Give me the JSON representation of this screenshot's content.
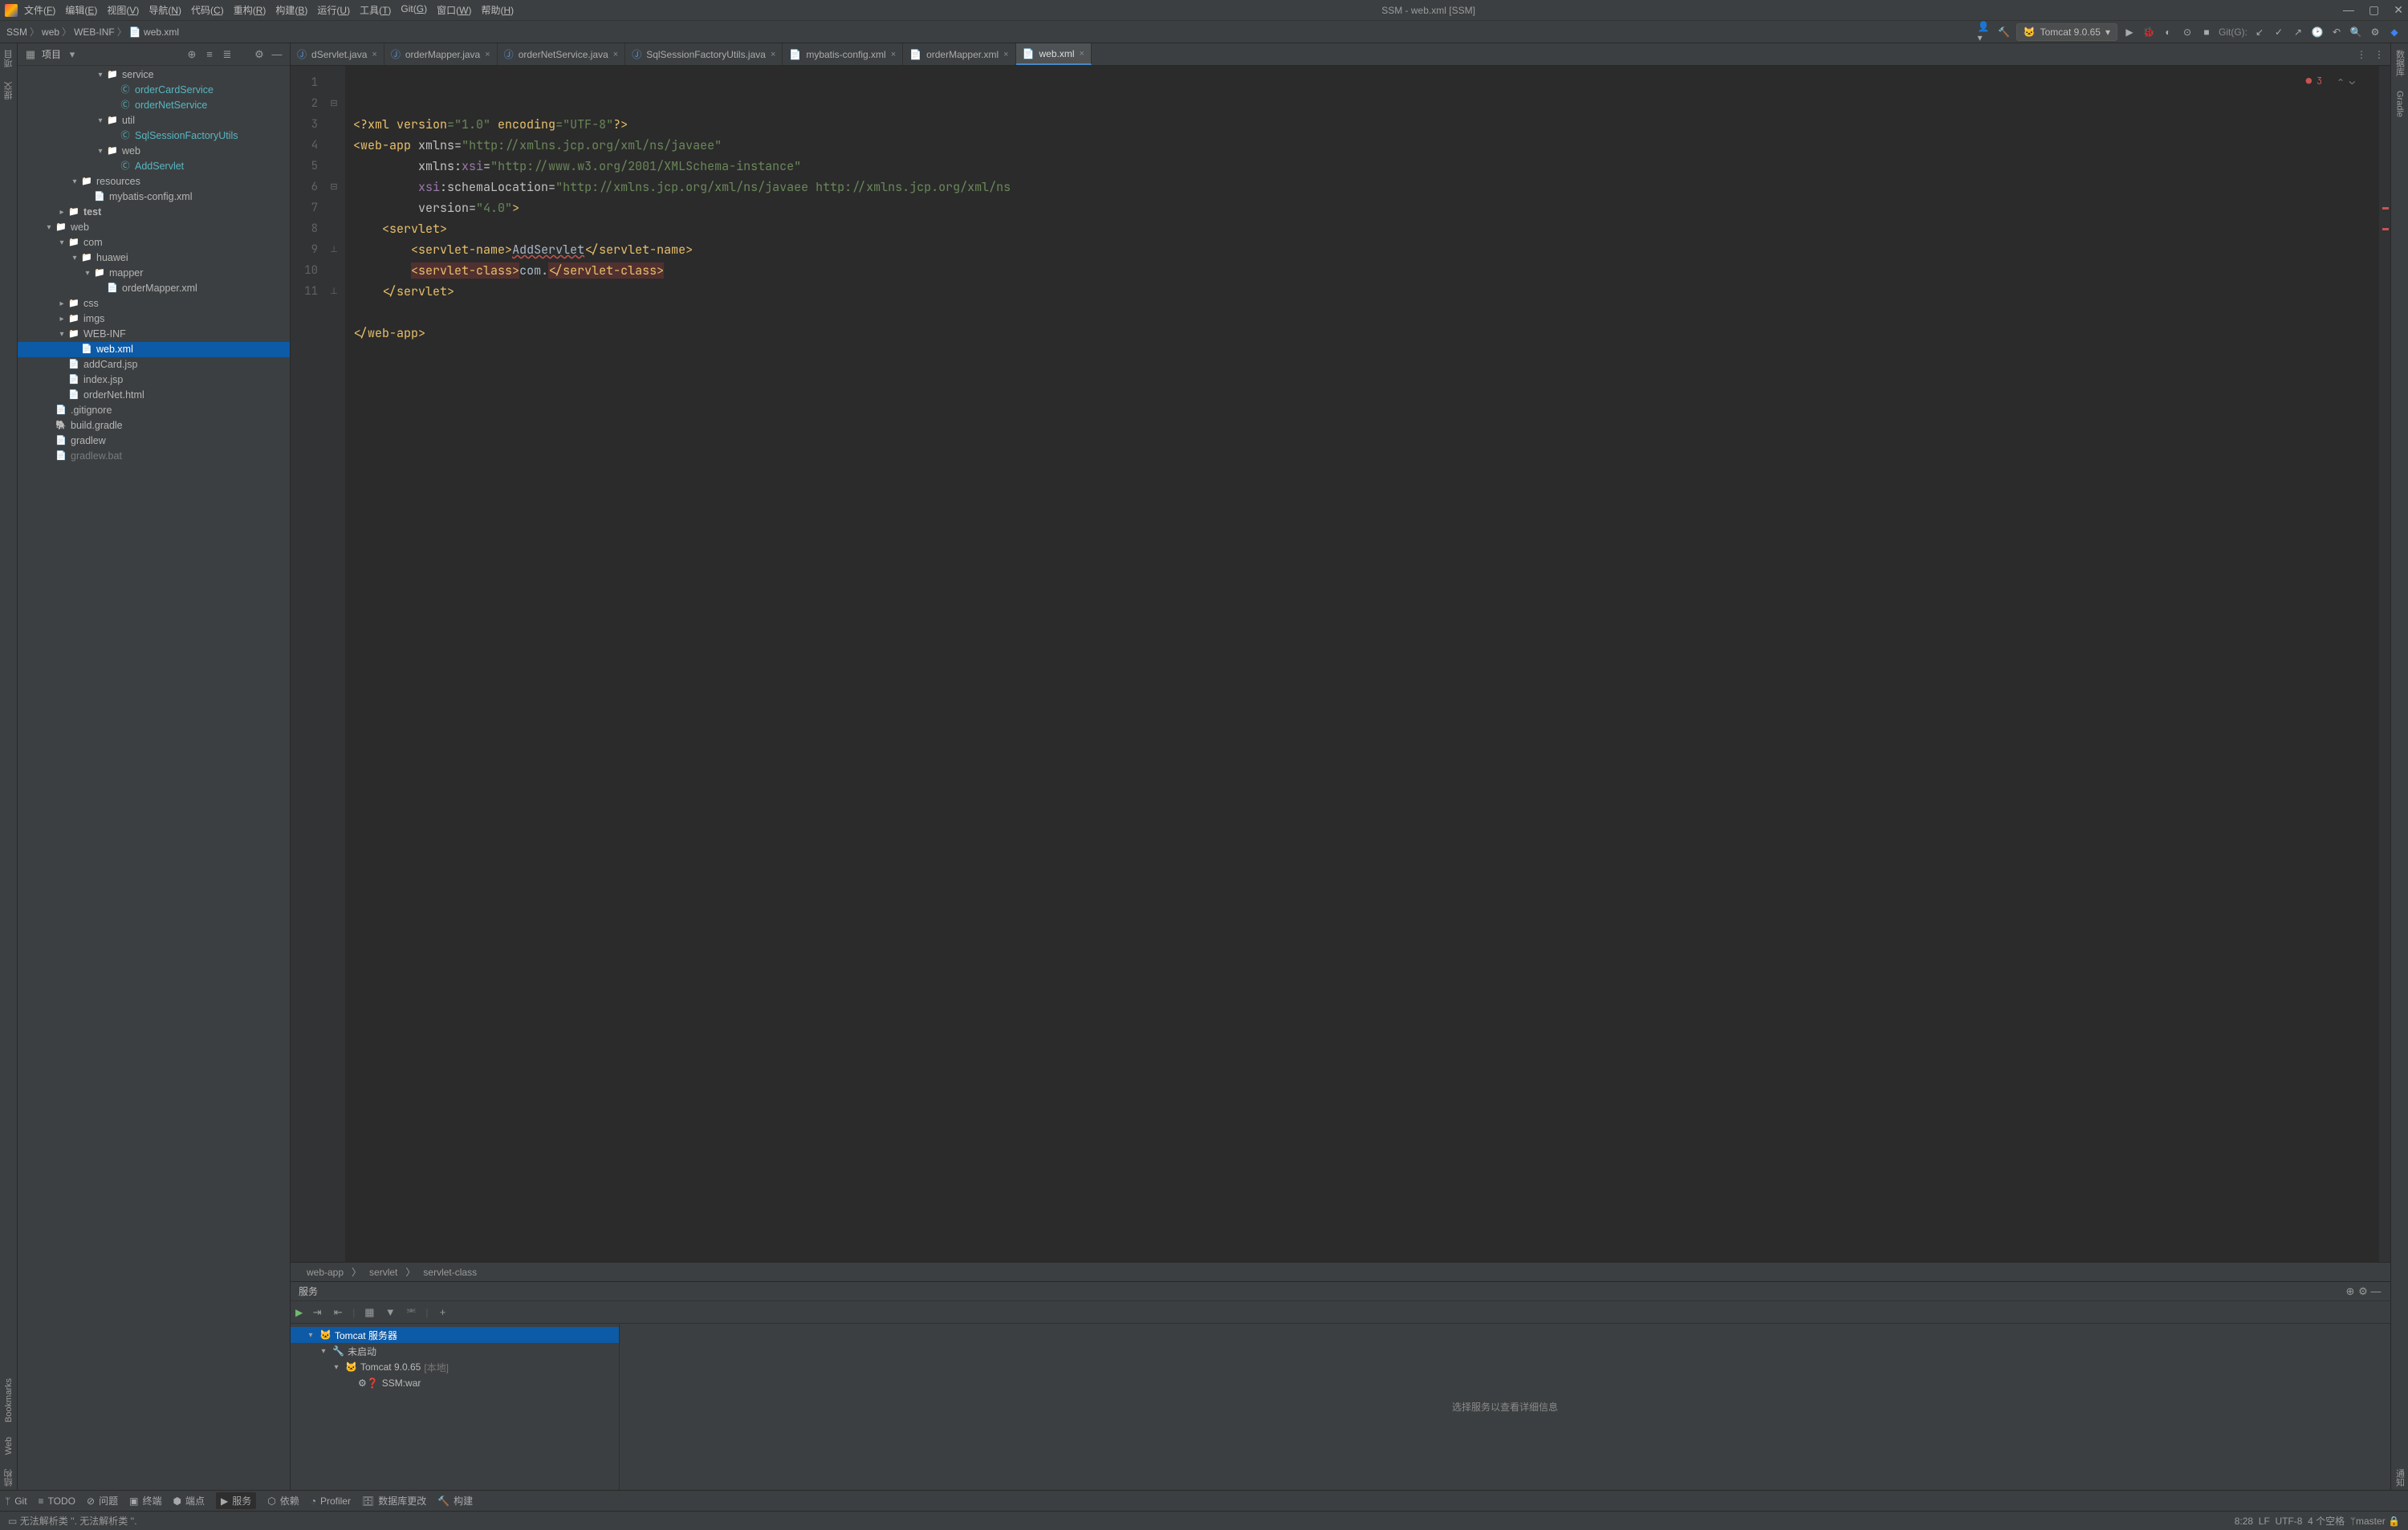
{
  "titlebar": {
    "menus": [
      "文件(F)",
      "编辑(E)",
      "视图(V)",
      "导航(N)",
      "代码(C)",
      "重构(R)",
      "构建(B)",
      "运行(U)",
      "工具(T)",
      "Git(G)",
      "窗口(W)",
      "帮助(H)"
    ],
    "title": "SSM - web.xml [SSM]"
  },
  "breadcrumb": {
    "parts": [
      "SSM",
      "web",
      "WEB-INF",
      "web.xml"
    ]
  },
  "run_config": "Tomcat 9.0.65",
  "git_label": "Git(G):",
  "left_tabs": {
    "project": "项目",
    "commit": "提交"
  },
  "left_bottom_tabs": [
    "Bookmarks",
    "Web",
    "结构"
  ],
  "right_tabs": [
    "数据库",
    "Gradle",
    "通知"
  ],
  "project_panel": {
    "title": "项目"
  },
  "tree": [
    {
      "d": 6,
      "c": "▾",
      "i": "folder",
      "t": "service"
    },
    {
      "d": 7,
      "c": "",
      "i": "class",
      "t": "orderCardService",
      "cy": true
    },
    {
      "d": 7,
      "c": "",
      "i": "class",
      "t": "orderNetService",
      "cy": true
    },
    {
      "d": 6,
      "c": "▾",
      "i": "folder",
      "t": "util"
    },
    {
      "d": 7,
      "c": "",
      "i": "class",
      "t": "SqlSessionFactoryUtils",
      "cy": true
    },
    {
      "d": 6,
      "c": "▾",
      "i": "folder",
      "t": "web"
    },
    {
      "d": 7,
      "c": "",
      "i": "class",
      "t": "AddServlet",
      "cy": true
    },
    {
      "d": 4,
      "c": "▾",
      "i": "folder",
      "t": "resources"
    },
    {
      "d": 5,
      "c": "",
      "i": "xml",
      "t": "mybatis-config.xml"
    },
    {
      "d": 3,
      "c": "▸",
      "i": "folder",
      "t": "test",
      "bold": true
    },
    {
      "d": 2,
      "c": "▾",
      "i": "folder",
      "t": "web"
    },
    {
      "d": 3,
      "c": "▾",
      "i": "folder",
      "t": "com"
    },
    {
      "d": 4,
      "c": "▾",
      "i": "folder",
      "t": "huawei"
    },
    {
      "d": 5,
      "c": "▾",
      "i": "folder",
      "t": "mapper"
    },
    {
      "d": 6,
      "c": "",
      "i": "xml",
      "t": "orderMapper.xml"
    },
    {
      "d": 3,
      "c": "▸",
      "i": "folder",
      "t": "css"
    },
    {
      "d": 3,
      "c": "▸",
      "i": "folder",
      "t": "imgs"
    },
    {
      "d": 3,
      "c": "▾",
      "i": "folder",
      "t": "WEB-INF"
    },
    {
      "d": 4,
      "c": "",
      "i": "xml",
      "t": "web.xml",
      "sel": true
    },
    {
      "d": 3,
      "c": "",
      "i": "jsp",
      "t": "addCard.jsp"
    },
    {
      "d": 3,
      "c": "",
      "i": "jsp",
      "t": "index.jsp"
    },
    {
      "d": 3,
      "c": "",
      "i": "html",
      "t": "orderNet.html"
    },
    {
      "d": 2,
      "c": "",
      "i": "txt",
      "t": ".gitignore"
    },
    {
      "d": 2,
      "c": "",
      "i": "gradle",
      "t": "build.gradle"
    },
    {
      "d": 2,
      "c": "",
      "i": "txt",
      "t": "gradlew"
    },
    {
      "d": 2,
      "c": "",
      "i": "txt",
      "t": "gradlew.bat",
      "dim": true
    }
  ],
  "editor_tabs": [
    {
      "label": "dServlet.java",
      "icon": "java"
    },
    {
      "label": "orderMapper.java",
      "icon": "java"
    },
    {
      "label": "orderNetService.java",
      "icon": "java"
    },
    {
      "label": "SqlSessionFactoryUtils.java",
      "icon": "java"
    },
    {
      "label": "mybatis-config.xml",
      "icon": "xml"
    },
    {
      "label": "orderMapper.xml",
      "icon": "xml"
    },
    {
      "label": "web.xml",
      "icon": "xml",
      "active": true
    }
  ],
  "error_count": "3",
  "code": {
    "lines": [
      1,
      2,
      3,
      4,
      5,
      6,
      7,
      8,
      9,
      10,
      11
    ],
    "l1_a": "<?",
    "l1_b": "xml version",
    "l1_c": "=\"1.0\"",
    "l1_d": " encoding",
    "l1_e": "=\"UTF-8\"",
    "l1_f": "?>",
    "l2_a": "<",
    "l2_b": "web-app ",
    "l2_c": "xmlns",
    "l2_d": "=",
    "l2_e": "\"http://xmlns.jcp.org/xml/ns/javaee\"",
    "l3_a": "xmlns:",
    "l3_b": "xsi",
    "l3_c": "=",
    "l3_d": "\"http://www.w3.org/2001/XMLSchema-instance\"",
    "l4_a": "xsi",
    "l4_b": ":schemaLocation",
    "l4_c": "=",
    "l4_d": "\"http://xmlns.jcp.org/xml/ns/javaee http://xmlns.jcp.org/xml/ns",
    "l5_a": "version",
    "l5_b": "=",
    "l5_c": "\"4.0\"",
    "l5_d": ">",
    "l6_a": "<",
    "l6_b": "servlet",
    "l6_c": ">",
    "l7_a": "<",
    "l7_b": "servlet-name",
    "l7_c": ">",
    "l7_d": "AddServlet",
    "l7_e": "</",
    "l7_f": "servlet-name",
    "l7_g": ">",
    "l8_a": "<",
    "l8_b": "servlet-class",
    "l8_c": ">",
    "l8_d": "com.",
    "l8_e": "</",
    "l8_f": "servlet-class",
    "l8_g": ">",
    "l9_a": "</",
    "l9_b": "servlet",
    "l9_c": ">",
    "l11_a": "</",
    "l11_b": "web-app",
    "l11_c": ">"
  },
  "crumb2": [
    "web-app",
    "servlet",
    "servlet-class"
  ],
  "services": {
    "panel_title": "服务",
    "root": "Tomcat 服务器",
    "state": "未启动",
    "node": "Tomcat 9.0.65",
    "node_scope": "[本地]",
    "artifact": "SSM:war",
    "placeholder": "选择服务以查看详细信息"
  },
  "bottom_tabs": [
    {
      "l": "Git",
      "i": "git"
    },
    {
      "l": "TODO",
      "i": "todo"
    },
    {
      "l": "问题",
      "i": "problems"
    },
    {
      "l": "终端",
      "i": "terminal"
    },
    {
      "l": "端点",
      "i": "endpoints"
    },
    {
      "l": "服务",
      "i": "services",
      "active": true
    },
    {
      "l": "依赖",
      "i": "deps"
    },
    {
      "l": "Profiler",
      "i": "profiler"
    },
    {
      "l": "数据库更改",
      "i": "dbchanges"
    },
    {
      "l": "构建",
      "i": "build"
    }
  ],
  "status": {
    "msg": "无法解析类 ''. 无法解析类 ''.",
    "pos": "8:28",
    "enc": "LF",
    "charset": "UTF-8",
    "indent": "4 个空格",
    "branch": "master"
  }
}
